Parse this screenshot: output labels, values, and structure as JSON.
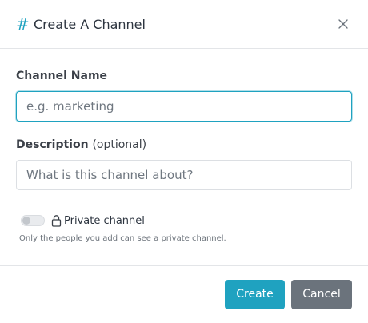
{
  "dialog": {
    "title": "Create A Channel",
    "hash_symbol": "#"
  },
  "form": {
    "channel_name": {
      "label": "Channel Name",
      "placeholder": "e.g. marketing",
      "value": ""
    },
    "description": {
      "label": "Description",
      "label_suffix": "(optional)",
      "placeholder": "What is this channel about?",
      "value": ""
    },
    "private": {
      "label": "Private channel",
      "help": "Only the people you add can see a private channel.",
      "enabled": false
    }
  },
  "footer": {
    "create_label": "Create",
    "cancel_label": "Cancel"
  },
  "colors": {
    "accent": "#1fa2c0",
    "cancel": "#6b737c"
  },
  "icons": {
    "hash": "hash-icon",
    "close": "close-icon",
    "lock": "lock-icon"
  }
}
